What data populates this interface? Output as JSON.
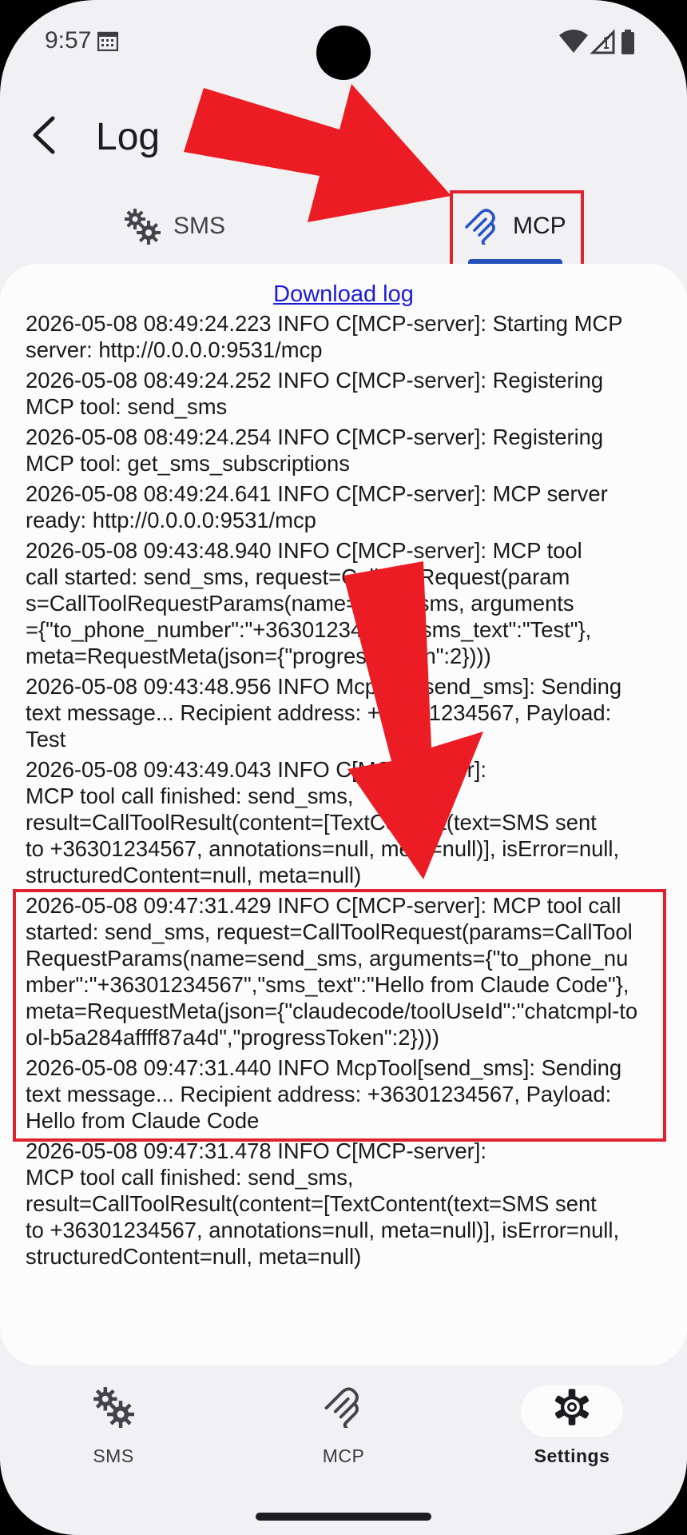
{
  "status_bar": {
    "time": "9:57"
  },
  "header": {
    "title": "Log"
  },
  "tabs": [
    {
      "label": "SMS",
      "icon": "gears-icon",
      "selected": false
    },
    {
      "label": "MCP",
      "icon": "mcp-logo-icon",
      "selected": true
    }
  ],
  "log": {
    "download_label": "Download log",
    "entries": [
      "2026-05-08 08:49:24.223 INFO C[MCP-server]: Starting MCP\nserver: http://0.0.0.0:9531/mcp",
      "2026-05-08 08:49:24.252 INFO C[MCP-server]: Registering\nMCP tool: send_sms",
      "2026-05-08 08:49:24.254 INFO C[MCP-server]: Registering\nMCP tool: get_sms_subscriptions",
      "2026-05-08 08:49:24.641 INFO C[MCP-server]: MCP server\nready: http://0.0.0.0:9531/mcp",
      "2026-05-08 09:43:48.940 INFO C[MCP-server]: MCP tool\ncall started: send_sms, request=CallToolRequest(param\ns=CallToolRequestParams(name=send_sms, arguments\n={\"to_phone_number\":\"+36301234567\",\"sms_text\":\"Test\"},\nmeta=RequestMeta(json={\"progressToken\":2})))",
      "2026-05-08 09:43:48.956 INFO McpTool[send_sms]: Sending\ntext message... Recipient address: +36301234567, Payload:\nTest",
      "2026-05-08 09:43:49.043 INFO C[MCP-server]:\nMCP tool call finished: send_sms,\nresult=CallToolResult(content=[TextContent(text=SMS sent\nto +36301234567, annotations=null, meta=null)], isError=null,\nstructuredContent=null, meta=null)",
      "2026-05-08 09:47:31.429 INFO C[MCP-server]: MCP tool call\nstarted: send_sms, request=CallToolRequest(params=CallTool\nRequestParams(name=send_sms, arguments={\"to_phone_nu\nmber\":\"+36301234567\",\"sms_text\":\"Hello from Claude Code\"},\nmeta=RequestMeta(json={\"claudecode/toolUseId\":\"chatcmpl-to\nol-b5a284affff87a4d\",\"progressToken\":2})))",
      "2026-05-08 09:47:31.440 INFO McpTool[send_sms]: Sending\ntext message... Recipient address: +36301234567, Payload:\nHello from Claude Code",
      "2026-05-08 09:47:31.478 INFO C[MCP-server]:\nMCP tool call finished: send_sms,\nresult=CallToolResult(content=[TextContent(text=SMS sent\nto +36301234567, annotations=null, meta=null)], isError=null,\nstructuredContent=null, meta=null)"
    ]
  },
  "bottom_nav": [
    {
      "label": "SMS",
      "icon": "gears-icon",
      "selected": false
    },
    {
      "label": "MCP",
      "icon": "mcp-logo-icon",
      "selected": false
    },
    {
      "label": "Settings",
      "icon": "gear-icon",
      "selected": true
    }
  ],
  "colors": {
    "annotation_red": "#e0222f",
    "tab_indicator": "#2551b8",
    "link": "#1b1bd8",
    "mcp_icon": "#2a55c4"
  }
}
